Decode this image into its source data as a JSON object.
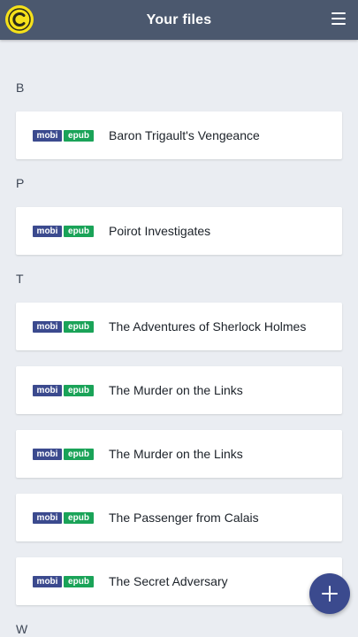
{
  "header": {
    "title": "Your files",
    "logo_icon": "calibre-logo-icon",
    "menu_icon": "hamburger-menu-icon"
  },
  "colors": {
    "header_bg": "#4b586e",
    "page_bg": "#eaedf2",
    "mobi_badge": "#3b4a8e",
    "epub_badge": "#1aa358",
    "fab": "#3b4a8e",
    "logo": "#f5e11a"
  },
  "sections": [
    {
      "letter": "B",
      "books": [
        {
          "title": "Baron Trigault's Vengeance",
          "formats": [
            "mobi",
            "epub"
          ]
        }
      ]
    },
    {
      "letter": "P",
      "books": [
        {
          "title": "Poirot Investigates",
          "formats": [
            "mobi",
            "epub"
          ]
        }
      ]
    },
    {
      "letter": "T",
      "books": [
        {
          "title": "The Adventures of Sherlock Holmes",
          "formats": [
            "mobi",
            "epub"
          ]
        },
        {
          "title": "The Murder on the Links",
          "formats": [
            "mobi",
            "epub"
          ]
        },
        {
          "title": "The Murder on the Links",
          "formats": [
            "mobi",
            "epub"
          ]
        },
        {
          "title": "The Passenger from Calais",
          "formats": [
            "mobi",
            "epub"
          ]
        },
        {
          "title": "The Secret Adversary",
          "formats": [
            "mobi",
            "epub"
          ]
        }
      ]
    },
    {
      "letter": "W",
      "books": []
    }
  ],
  "fab": {
    "icon": "plus-icon"
  }
}
